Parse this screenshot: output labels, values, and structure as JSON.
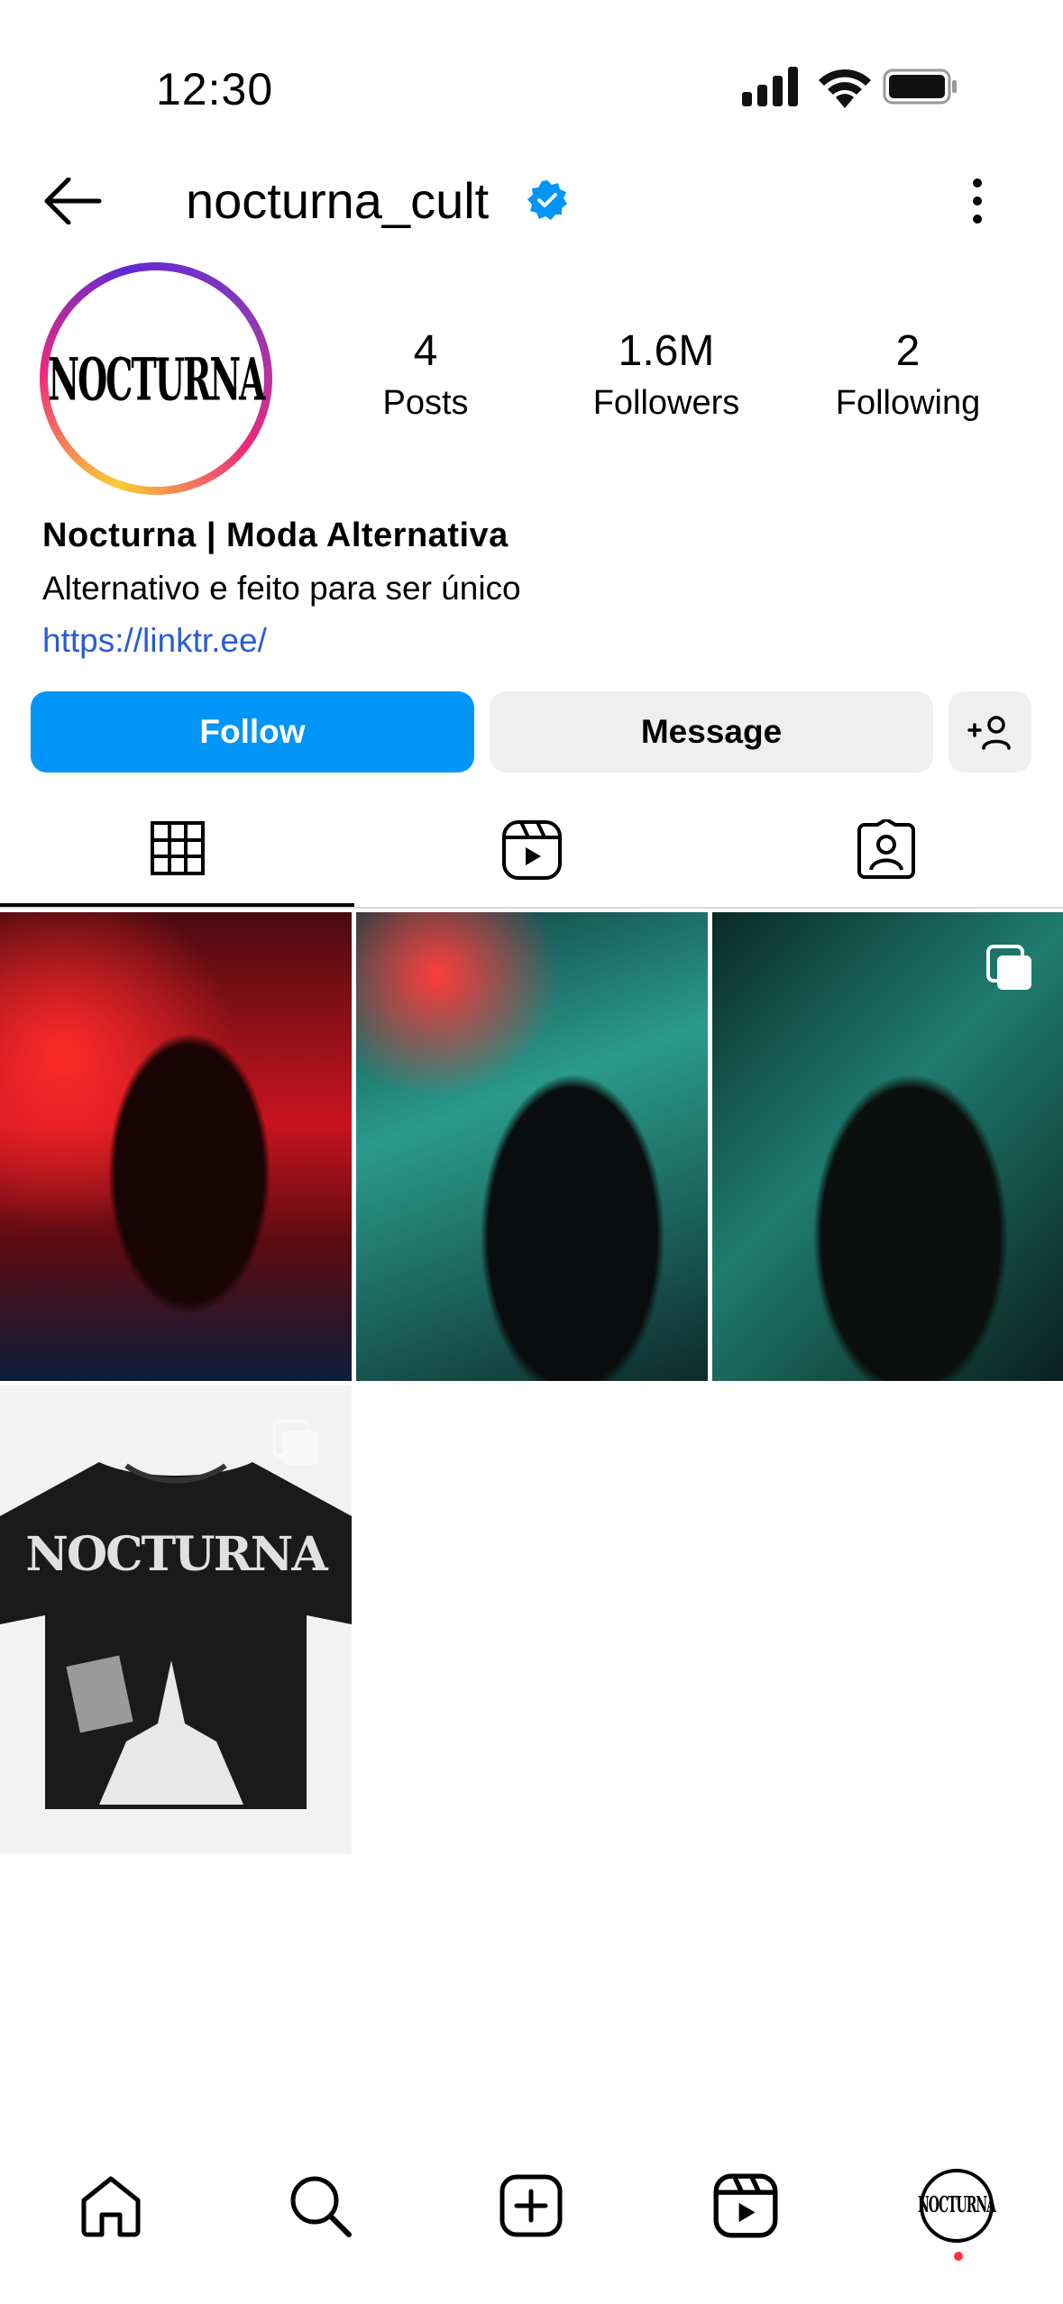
{
  "status_bar": {
    "time": "12:30"
  },
  "header": {
    "username": "nocturna_cult",
    "verified": true
  },
  "profile": {
    "avatar_text": "NOCTURNA",
    "stats": [
      {
        "value": "4",
        "label": "Posts"
      },
      {
        "value": "1.6M",
        "label": "Followers"
      },
      {
        "value": "2",
        "label": "Following"
      }
    ],
    "display_name": "Nocturna | Moda Alternativa",
    "bio": "Alternativo e feito para ser único",
    "link": "https://linktr.ee/"
  },
  "actions": {
    "follow_label": "Follow",
    "message_label": "Message",
    "add_person_icon": "add-person-icon"
  },
  "tabs": [
    {
      "name": "grid",
      "icon": "grid-icon",
      "active": true
    },
    {
      "name": "reels",
      "icon": "reels-icon",
      "active": false
    },
    {
      "name": "tagged",
      "icon": "tagged-icon",
      "active": false
    }
  ],
  "posts": [
    {
      "subject": "person-red-neon-alley",
      "multi": false
    },
    {
      "subject": "person-teal-neon-street",
      "multi": false
    },
    {
      "subject": "person-hood-teal-light",
      "multi": true
    },
    {
      "subject": "black-tshirt-nocturna",
      "multi": true,
      "print_text": "NOCTURNA"
    }
  ],
  "bottom_nav": [
    {
      "name": "home",
      "icon": "home-icon"
    },
    {
      "name": "search",
      "icon": "search-icon"
    },
    {
      "name": "create",
      "icon": "create-icon"
    },
    {
      "name": "reels",
      "icon": "reels-icon"
    },
    {
      "name": "profile",
      "icon": "profile-avatar",
      "avatar_text": "NOCTURNA",
      "notification": true
    }
  ],
  "colors": {
    "accent": "#0095f6",
    "link": "#2a5bd7",
    "secondary_button": "#efefef",
    "notification": "#ff3040"
  }
}
